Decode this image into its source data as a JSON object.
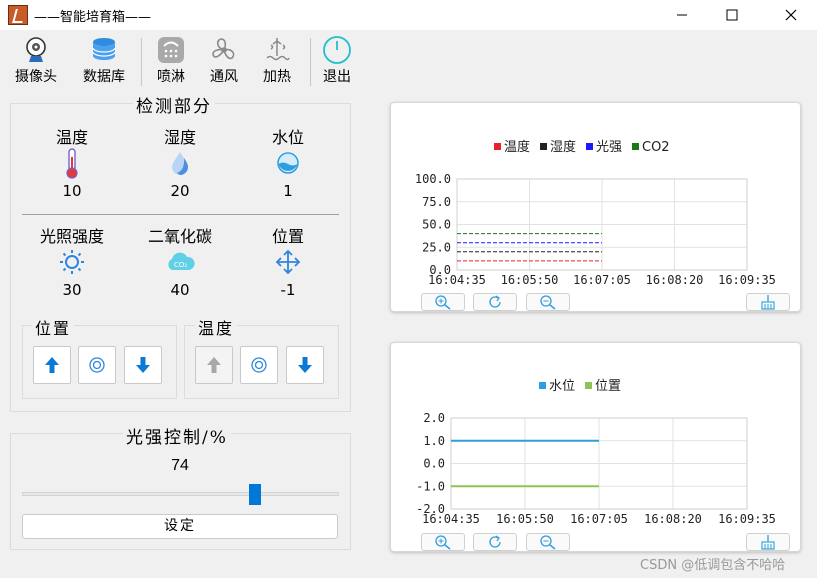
{
  "window": {
    "title": "——智能培育箱——"
  },
  "toolbar": {
    "camera": "摄像头",
    "database": "数据库",
    "spray": "喷淋",
    "ventilate": "通风",
    "heat": "加热",
    "exit": "退出"
  },
  "detect": {
    "title": "检测部分",
    "temperature": {
      "label": "温度",
      "value": "10"
    },
    "humidity": {
      "label": "湿度",
      "value": "20"
    },
    "water": {
      "label": "水位",
      "value": "1"
    },
    "light": {
      "label": "光照强度",
      "value": "30"
    },
    "co2": {
      "label": "二氧化碳",
      "value": "40"
    },
    "position": {
      "label": "位置",
      "value": "-1"
    },
    "position_group": "位置",
    "temperature_group": "温度"
  },
  "light_control": {
    "title": "光强控制/%",
    "value": "74",
    "slider_fraction": 0.74,
    "set_label": "设定"
  },
  "colors": {
    "accent": "#0078d7",
    "exit": "#1fbfd0"
  },
  "chart_data": [
    {
      "type": "line",
      "legend": [
        "温度",
        "湿度",
        "光强",
        "CO2"
      ],
      "series": [
        {
          "name": "温度",
          "color": "#e8202a",
          "style": "dashed",
          "x": [
            "16:04:35",
            "16:07:05"
          ],
          "values": [
            10,
            10
          ]
        },
        {
          "name": "湿度",
          "color": "#222222",
          "style": "dashed",
          "x": [
            "16:04:35",
            "16:07:05"
          ],
          "values": [
            20,
            20
          ]
        },
        {
          "name": "光强",
          "color": "#1a1aff",
          "style": "dashed",
          "x": [
            "16:04:35",
            "16:07:05"
          ],
          "values": [
            30,
            30
          ]
        },
        {
          "name": "CO2",
          "color": "#1a7a1a",
          "style": "dashed",
          "x": [
            "16:04:35",
            "16:07:05"
          ],
          "values": [
            40,
            40
          ]
        }
      ],
      "y_ticks": [
        "100.0",
        "75.0",
        "50.0",
        "25.0",
        "0.0"
      ],
      "ylim": [
        0,
        100
      ],
      "x_ticks": [
        "16:04:35",
        "16:05:50",
        "16:07:05",
        "16:08:20",
        "16:09:35"
      ],
      "grid": true
    },
    {
      "type": "line",
      "legend": [
        "水位",
        "位置"
      ],
      "series": [
        {
          "name": "水位",
          "color": "#2e9fde",
          "style": "solid",
          "x": [
            "16:04:35",
            "16:07:05"
          ],
          "values": [
            1,
            1
          ]
        },
        {
          "name": "位置",
          "color": "#8dc455",
          "style": "solid",
          "x": [
            "16:04:35",
            "16:07:05"
          ],
          "values": [
            -1,
            -1
          ]
        }
      ],
      "y_ticks": [
        "2.0",
        "1.0",
        "0.0",
        "-1.0",
        "-2.0"
      ],
      "ylim": [
        -2,
        2
      ],
      "x_ticks": [
        "16:04:35",
        "16:05:50",
        "16:07:05",
        "16:08:20",
        "16:09:35"
      ],
      "grid": true
    }
  ],
  "watermark": "CSDN @低调包含不哈哈"
}
